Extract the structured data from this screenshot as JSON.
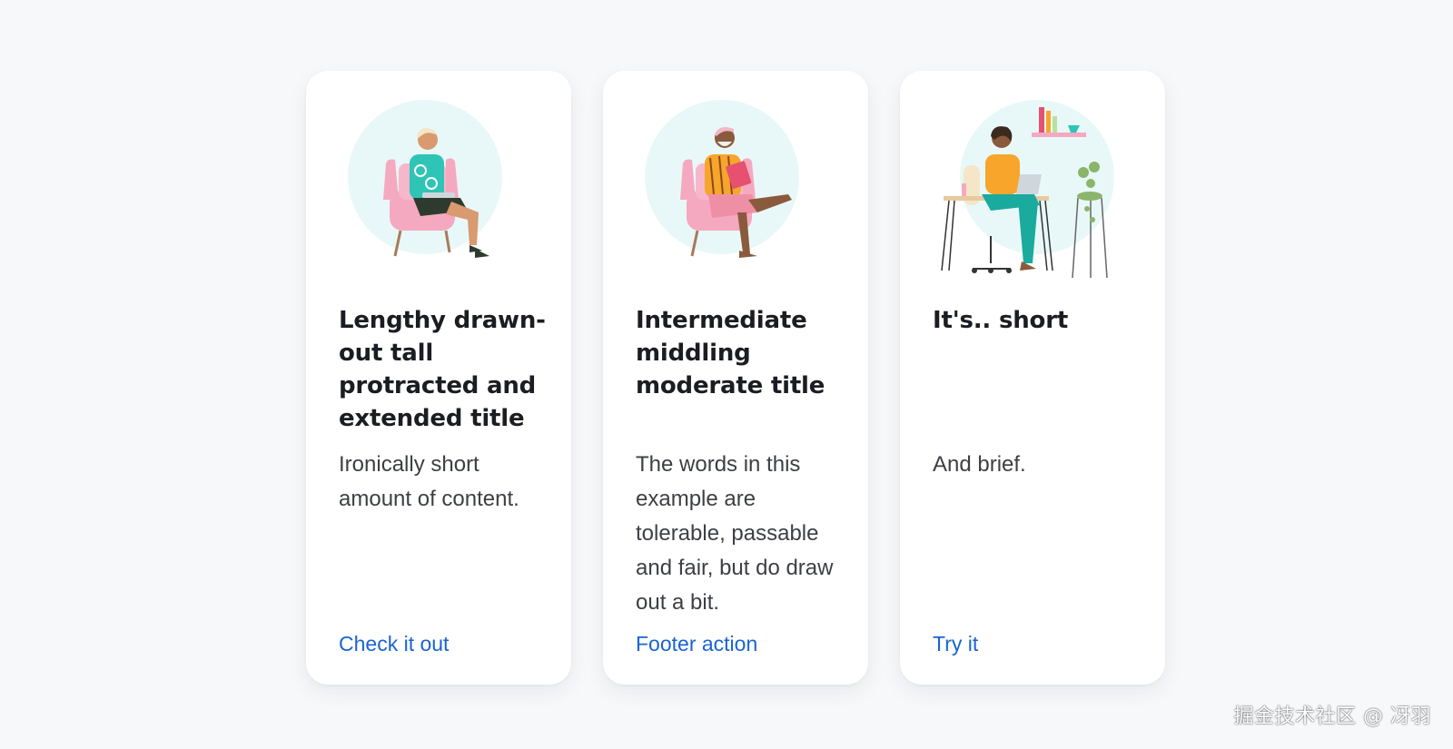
{
  "cards": [
    {
      "title": "Lengthy drawn-out tall protracted and extended title",
      "content": "Ironically short amount of content.",
      "action": "Check it out",
      "illustration": "person-reading-laptop-in-armchair-illustration"
    },
    {
      "title": "Intermediate middling moderate title",
      "content": "The words in this example are tolerable, passable and fair, but do draw out a bit.",
      "action": "Footer action",
      "illustration": "person-reading-book-in-armchair-illustration"
    },
    {
      "title": "It's.. short",
      "content": "And brief.",
      "action": "Try it",
      "illustration": "person-working-at-desk-illustration"
    }
  ],
  "watermark": "掘金技术社区 @ 冴羽",
  "colors": {
    "page_background": "#f7f8fa",
    "card_background": "#ffffff",
    "title": "#1c1d22",
    "body_text": "#3d3f45",
    "link": "#1a64d1",
    "illustration_circle": "#e8f8f8",
    "chair": "#f5a9c0"
  }
}
